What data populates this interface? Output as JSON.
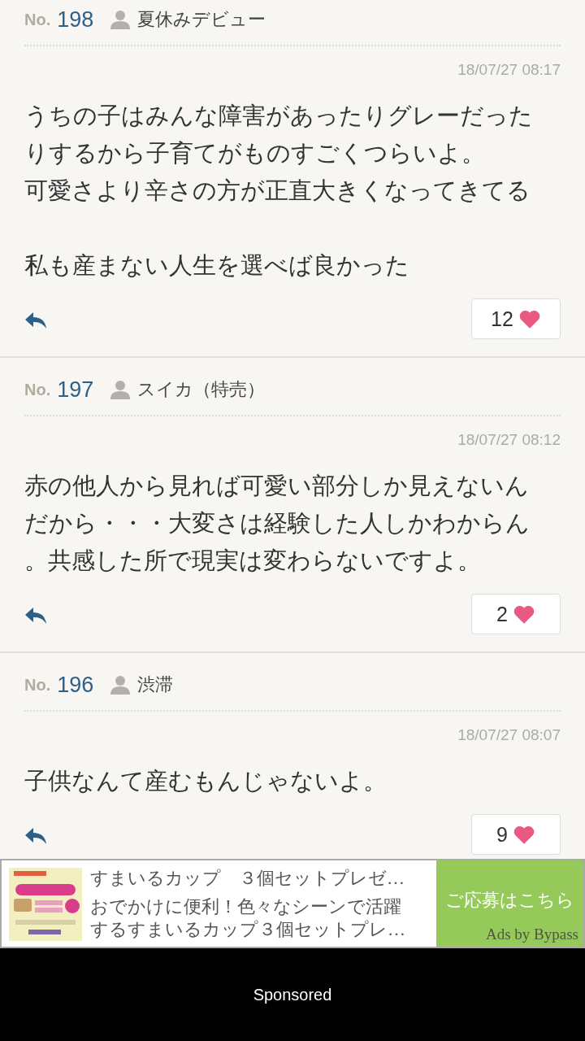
{
  "posts": [
    {
      "no_label": "No.",
      "number": "198",
      "author": "夏休みデビュー",
      "date": "18/07/27 08:17",
      "paragraphs": [
        [
          "うちの子はみんな障害があったりグレーだった",
          "りするから子育てがものすごくつらいよ。",
          "可愛さより辛さの方が正直大きくなってきてる"
        ],
        [
          "私も産まない人生を選べば良かった"
        ]
      ],
      "likes": "12"
    },
    {
      "no_label": "No.",
      "number": "197",
      "author": "スイカ（特売）",
      "date": "18/07/27 08:12",
      "paragraphs": [
        [
          "赤の他人から見れば可愛い部分しか見えないん",
          "だから・・・大変さは経験した人しかわからん",
          "。共感した所で現実は変わらないですよ。"
        ]
      ],
      "likes": "2"
    },
    {
      "no_label": "No.",
      "number": "196",
      "author": "渋滞",
      "date": "18/07/27 08:07",
      "paragraphs": [
        [
          "子供なんて産むもんじゃないよ。"
        ]
      ],
      "likes": "9"
    }
  ],
  "ad": {
    "image": {
      "kind": "picture"
    },
    "title": "すまいるカップ　３個セットプレゼ…",
    "description": [
      "おでかけに便利！色々なシーンで活躍",
      "するすまいるカップ３個セットプレ…"
    ],
    "cta": "ご応募はこちら",
    "attribution": "Ads by Bypass"
  },
  "footer": {
    "label": "Sponsored"
  }
}
